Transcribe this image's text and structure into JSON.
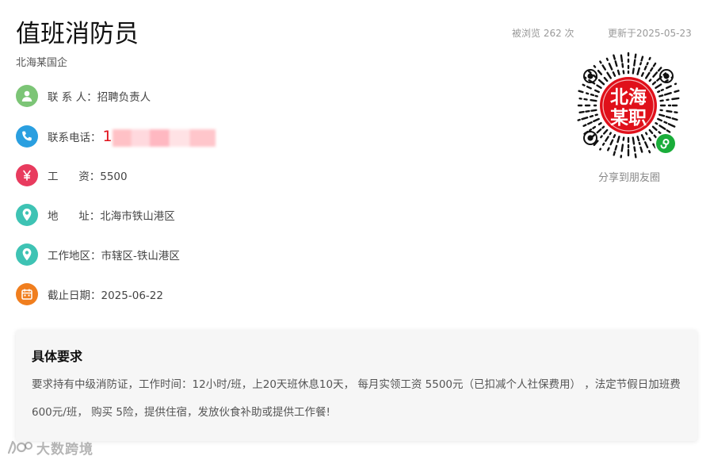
{
  "job": {
    "title": "值班消防员",
    "company": "北海某国企",
    "views_text": "被浏览 262 次",
    "updated_text": "更新于2025-05-23"
  },
  "details": {
    "contact": {
      "label": "联 系 人：",
      "value": "招聘负责人",
      "icon": "person-icon",
      "color": "#7cc576"
    },
    "phone": {
      "label": "联系电话：",
      "value": "1",
      "icon": "phone-icon",
      "color": "#2a9fe0"
    },
    "salary": {
      "label": "工      资：",
      "value": "5500",
      "icon": "yen-icon",
      "color": "#e83b5e"
    },
    "address": {
      "label": "地      址：",
      "value": "北海市铁山港区",
      "icon": "location-pin-icon",
      "color": "#3ec3b4"
    },
    "area": {
      "label": "工作地区：",
      "value": "市辖区-铁山港区",
      "icon": "location-pin-icon",
      "color": "#3ec3b4"
    },
    "deadline": {
      "label": "截止日期：",
      "value": "2025-06-22",
      "icon": "calendar-icon",
      "color": "#f07e1e"
    }
  },
  "qr": {
    "badge_line1": "北海",
    "badge_line2": "某职",
    "badge_color": "#e0101a",
    "share_label": "分享到朋友圈"
  },
  "requirements": {
    "title": "具体要求",
    "body": "要求持有中级消防证，工作时间：12小时/班，上20天班休息10天， 每月实领工资 5500元（已扣减个人社保费用） ，法定节假日加班费 600元/班， 购买 5险，提供住宿，发放伙食补助或提供工作餐!"
  },
  "watermark": {
    "text": "大数跨境"
  }
}
